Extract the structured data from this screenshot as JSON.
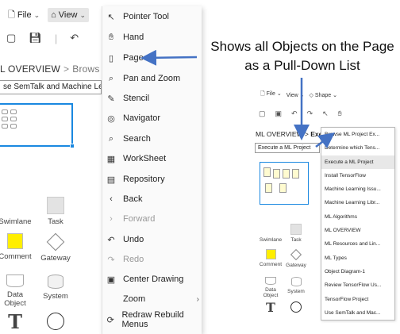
{
  "left_app": {
    "menu": {
      "file_label": "File",
      "view_label": "View"
    },
    "breadcrumb": {
      "page": "L OVERVIEW",
      "next": "Brows"
    },
    "select_value": "se SemTalk and Machine Le",
    "stencil": [
      {
        "label": "Swimlane",
        "shape": "rect"
      },
      {
        "label": "Task",
        "shape": "rect"
      },
      {
        "label": "Comment",
        "shape": "yellow-square"
      },
      {
        "label": "Gateway",
        "shape": "diamond"
      },
      {
        "label": "Data Object",
        "shape": "document"
      },
      {
        "label": "System",
        "shape": "cylinder"
      },
      {
        "label": "T",
        "shape": "text"
      },
      {
        "label": "",
        "shape": "circle"
      }
    ]
  },
  "view_menu": [
    {
      "label": "Pointer Tool",
      "icon": "pointer-icon",
      "disabled": false,
      "submenu": false
    },
    {
      "label": "Hand",
      "icon": "hand-icon",
      "disabled": false,
      "submenu": false
    },
    {
      "label": "Page",
      "icon": "page-icon",
      "disabled": false,
      "submenu": false
    },
    {
      "label": "Pan and Zoom",
      "icon": "zoom-icon",
      "disabled": false,
      "submenu": false
    },
    {
      "label": "Stencil",
      "icon": "stencil-icon",
      "disabled": false,
      "submenu": false
    },
    {
      "label": "Navigator",
      "icon": "navigator-icon",
      "disabled": false,
      "submenu": false
    },
    {
      "label": "Search",
      "icon": "search-icon",
      "disabled": false,
      "submenu": false
    },
    {
      "label": "WorkSheet",
      "icon": "worksheet-icon",
      "disabled": false,
      "submenu": false
    },
    {
      "label": "Repository",
      "icon": "repository-icon",
      "disabled": false,
      "submenu": false
    },
    {
      "label": "Back",
      "icon": "back-icon",
      "disabled": false,
      "submenu": false
    },
    {
      "label": "Forward",
      "icon": "forward-icon",
      "disabled": true,
      "submenu": false
    },
    {
      "label": "Undo",
      "icon": "undo-icon",
      "disabled": false,
      "submenu": false
    },
    {
      "label": "Redo",
      "icon": "redo-icon",
      "disabled": true,
      "submenu": false
    },
    {
      "label": "Center Drawing",
      "icon": "center-drawing-icon",
      "disabled": false,
      "submenu": false
    },
    {
      "label": "Zoom",
      "icon": "",
      "disabled": false,
      "submenu": true
    },
    {
      "label": "Redraw Rebuild Menus",
      "icon": "redraw-icon",
      "disabled": false,
      "submenu": false
    }
  ],
  "annotation": {
    "line1": "Shows all Objects on the Page",
    "line2": "as a Pull-Down List",
    "arrow_color": "#4472c4"
  },
  "inset": {
    "menu": {
      "file_label": "File",
      "view_label": "View",
      "shape_label": "Shape"
    },
    "breadcrumb": {
      "page": "ML OVERVIEW",
      "next": "Exe"
    },
    "select_value": "Execute a ML Project",
    "stencil": [
      {
        "label": "Swimlane",
        "shape": "rect"
      },
      {
        "label": "Task",
        "shape": "rect"
      },
      {
        "label": "Comment",
        "shape": "yellow-square"
      },
      {
        "label": "Gateway",
        "shape": "diamond"
      },
      {
        "label": "Data Object",
        "shape": "document"
      },
      {
        "label": "System",
        "shape": "cylinder"
      },
      {
        "label": "T",
        "shape": "text"
      },
      {
        "label": "",
        "shape": "circle"
      }
    ],
    "dropdown_items": [
      {
        "label": "Browse ML Project Ex...",
        "selected": false
      },
      {
        "label": "Determine which Tens...",
        "selected": false
      },
      {
        "label": "Execute a ML Project",
        "selected": true
      },
      {
        "label": "Install TensorFlow",
        "selected": false
      },
      {
        "label": "Machine Learning Issu...",
        "selected": false
      },
      {
        "label": "Machine Learning Libr...",
        "selected": false
      },
      {
        "label": "ML Algorithms",
        "selected": false
      },
      {
        "label": "ML OVERVIEW",
        "selected": false
      },
      {
        "label": "ML Resources and Lin...",
        "selected": false
      },
      {
        "label": "ML Types",
        "selected": false
      },
      {
        "label": "Object Diagram-1",
        "selected": false
      },
      {
        "label": "Review TensorFlow Us...",
        "selected": false
      },
      {
        "label": "TensorFlow Project",
        "selected": false
      },
      {
        "label": "Use SemTalk and Mac...",
        "selected": false
      }
    ]
  },
  "colors": {
    "accent": "#1a88e0",
    "comment_fill": "#ffee00",
    "selection": "#e8e8e8"
  }
}
